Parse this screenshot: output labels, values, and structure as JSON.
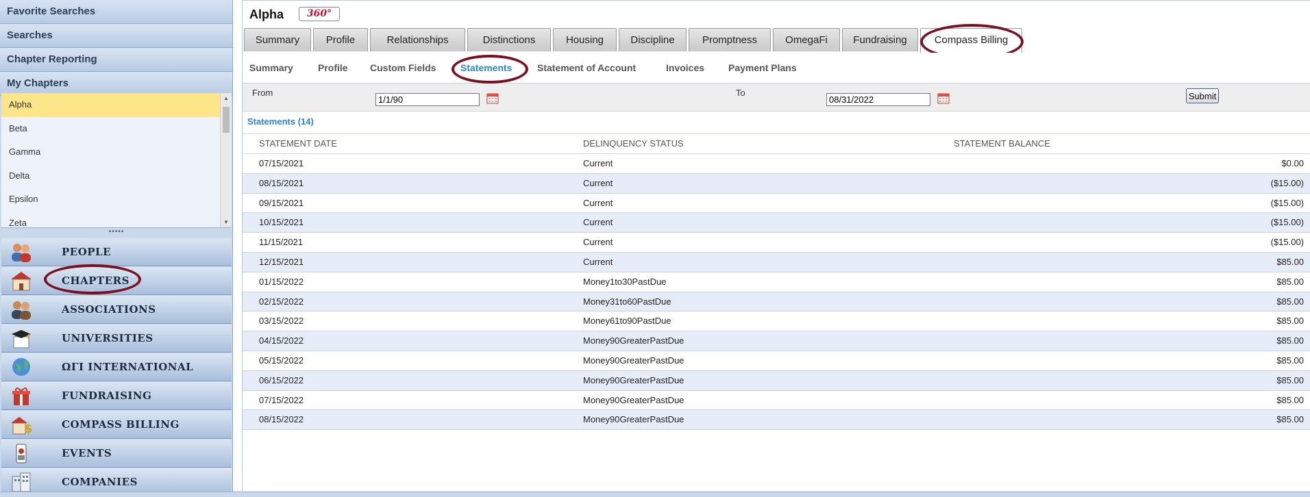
{
  "sidebar": {
    "headers": [
      "Favorite Searches",
      "Searches",
      "Chapter Reporting",
      "My Chapters"
    ],
    "chapters": [
      "Alpha",
      "Beta",
      "Gamma",
      "Delta",
      "Epsilon",
      "Zeta"
    ],
    "selected_chapter": "Alpha",
    "nav": [
      {
        "label": "PEOPLE",
        "icon": "people-icon"
      },
      {
        "label": "CHAPTERS",
        "icon": "chapter-house-icon"
      },
      {
        "label": "ASSOCIATIONS",
        "icon": "associations-icon"
      },
      {
        "label": "UNIVERSITIES",
        "icon": "graduation-cap-icon"
      },
      {
        "label": "ΩΓΙ INTERNATIONAL",
        "icon": "globe-icon"
      },
      {
        "label": "FUNDRAISING",
        "icon": "gift-icon"
      },
      {
        "label": "COMPASS BILLING",
        "icon": "billing-house-icon"
      },
      {
        "label": "EVENTS",
        "icon": "badge-icon"
      },
      {
        "label": "COMPANIES",
        "icon": "building-icon"
      }
    ]
  },
  "header": {
    "title": "Alpha",
    "badge": "360°"
  },
  "tabs": [
    "Summary",
    "Profile",
    "Relationships",
    "Distinctions",
    "Housing",
    "Discipline",
    "Promptness",
    "OmegaFi",
    "Fundraising",
    "Compass Billing"
  ],
  "active_tab": "Compass Billing",
  "subtabs": [
    "Summary",
    "Profile",
    "Custom Fields",
    "Statements",
    "Statement of Account",
    "Invoices",
    "Payment Plans"
  ],
  "active_subtab": "Statements",
  "filter": {
    "from_label": "From",
    "from_value": "1/1/90",
    "to_label": "To",
    "to_value": "08/31/2022",
    "submit_label": "Submit"
  },
  "statements": {
    "heading": "Statements (14)",
    "columns": [
      "STATEMENT DATE",
      "DELINQUENCY STATUS",
      "STATEMENT BALANCE"
    ],
    "rows": [
      [
        "07/15/2021",
        "Current",
        "$0.00"
      ],
      [
        "08/15/2021",
        "Current",
        "($15.00)"
      ],
      [
        "09/15/2021",
        "Current",
        "($15.00)"
      ],
      [
        "10/15/2021",
        "Current",
        "($15.00)"
      ],
      [
        "11/15/2021",
        "Current",
        "($15.00)"
      ],
      [
        "12/15/2021",
        "Current",
        "$85.00"
      ],
      [
        "01/15/2022",
        "Money1to30PastDue",
        "$85.00"
      ],
      [
        "02/15/2022",
        "Money31to60PastDue",
        "$85.00"
      ],
      [
        "03/15/2022",
        "Money61to90PastDue",
        "$85.00"
      ],
      [
        "04/15/2022",
        "Money90GreaterPastDue",
        "$85.00"
      ],
      [
        "05/15/2022",
        "Money90GreaterPastDue",
        "$85.00"
      ],
      [
        "06/15/2022",
        "Money90GreaterPastDue",
        "$85.00"
      ],
      [
        "07/15/2022",
        "Money90GreaterPastDue",
        "$85.00"
      ],
      [
        "08/15/2022",
        "Money90GreaterPastDue",
        "$85.00"
      ]
    ]
  },
  "colors": {
    "accent": "#2a86c9",
    "annotation": "#7a1020",
    "selected": "#fde68a",
    "row_alt": "#e6edf8"
  }
}
